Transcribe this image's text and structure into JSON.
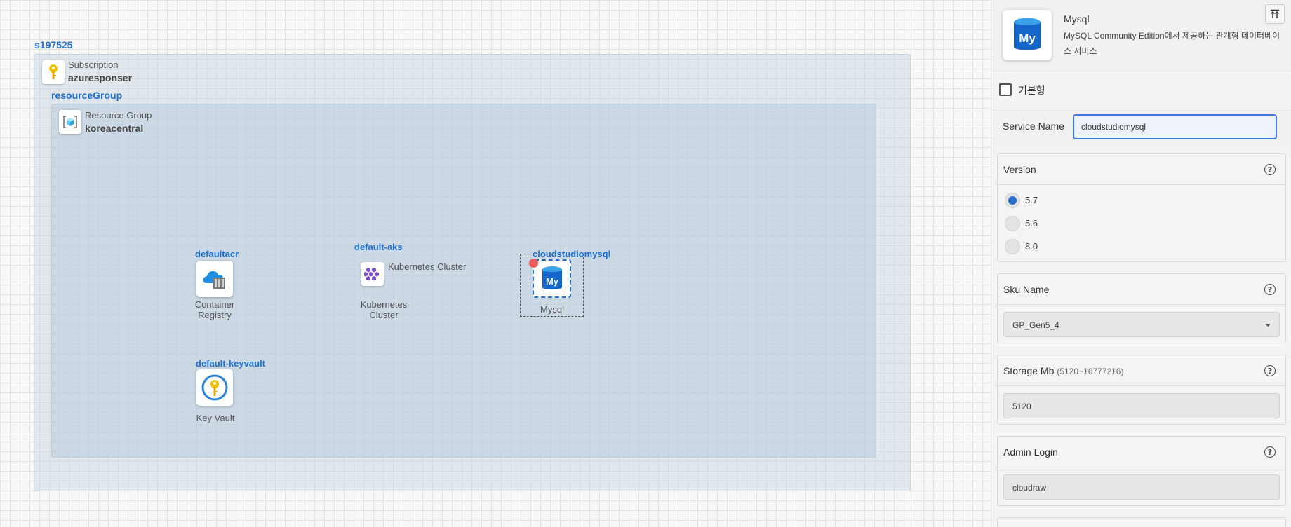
{
  "canvas": {
    "subscription": {
      "group_label": "s197525",
      "type_label": "Subscription",
      "name": "azuresponser"
    },
    "resource_group": {
      "group_label": "resourceGroup",
      "type_label": "Resource Group",
      "name": "koreacentral"
    },
    "nodes": {
      "acr": {
        "label": "defaultacr",
        "caption_line1": "Container",
        "caption_line2": "Registry"
      },
      "aks": {
        "label": "default-aks",
        "inline_caption": "Kubernetes Cluster",
        "caption_line1": "Kubernetes",
        "caption_line2": "Cluster"
      },
      "mysql": {
        "label": "cloudstudiomysql",
        "caption": "Mysql"
      },
      "keyvault": {
        "label": "default-keyvault",
        "caption": "Key Vault"
      }
    }
  },
  "panel": {
    "title": "Mysql",
    "description": "MySQL Community Edition에서 제공하는 관계형 데이터베이스 서비스",
    "collapse_icon": "collapse-top-icon",
    "basic_checkbox_label": "기본형",
    "service_name": {
      "label": "Service Name",
      "value": "cloudstudiomysql"
    },
    "version": {
      "title": "Version",
      "options": [
        "5.7",
        "5.6",
        "8.0"
      ],
      "selected": "5.7"
    },
    "sku": {
      "title": "Sku Name",
      "value": "GP_Gen5_4"
    },
    "storage": {
      "title": "Storage Mb",
      "hint": "(5120~16777216)",
      "value": "5120"
    },
    "admin_login": {
      "title": "Admin Login",
      "value": "cloudraw"
    },
    "help_glyph": "?"
  },
  "colors": {
    "accent": "#1e6fd2",
    "selection_dot": "#ef5b5b",
    "radio_selected": "#2d6fcf"
  }
}
